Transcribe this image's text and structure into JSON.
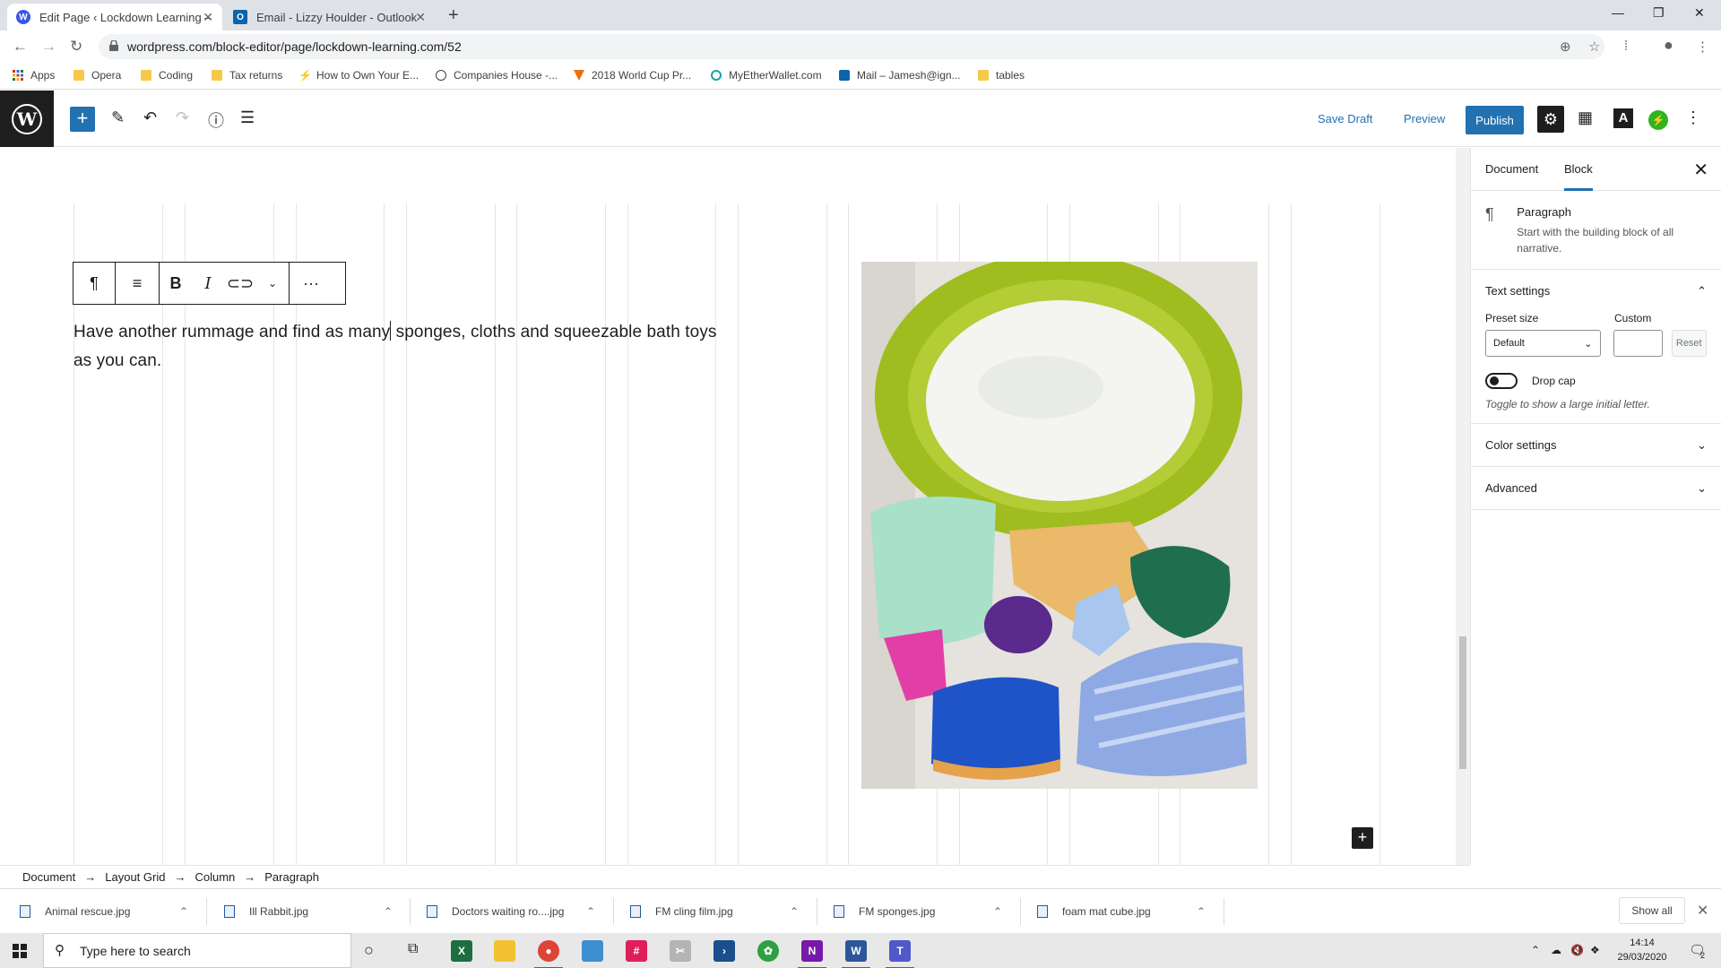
{
  "browser": {
    "tabs": [
      {
        "title": "Edit Page ‹ Lockdown Learning –",
        "active": true
      },
      {
        "title": "Email - Lizzy Houlder - Outlook",
        "active": false
      }
    ],
    "url": "wordpress.com/block-editor/page/lockdown-learning.com/52",
    "bookmarks": [
      {
        "label": "Apps",
        "icon": "apps-grid-icon"
      },
      {
        "label": "Opera",
        "icon": "folder-icon"
      },
      {
        "label": "Coding",
        "icon": "folder-icon"
      },
      {
        "label": "Tax returns",
        "icon": "folder-icon"
      },
      {
        "label": "How to Own Your E...",
        "icon": "lightning-icon"
      },
      {
        "label": "Companies House -...",
        "icon": "globe-icon"
      },
      {
        "label": "2018 World Cup Pr...",
        "icon": "site-icon"
      },
      {
        "label": "MyEtherWallet.com",
        "icon": "site-icon"
      },
      {
        "label": "Mail – Jamesh@ign...",
        "icon": "outlook-icon"
      },
      {
        "label": "tables",
        "icon": "folder-icon"
      }
    ]
  },
  "editor": {
    "save_draft": "Save Draft",
    "preview": "Preview",
    "publish": "Publish",
    "paragraph_text_before": "Have another rummage and find as many",
    "paragraph_text_after": " sponges, cloths and squeezable bath toys as you can."
  },
  "sidebar": {
    "tabs": [
      "Document",
      "Block"
    ],
    "active_tab": "Block",
    "block_name": "Paragraph",
    "block_description": "Start with the building block of all narrative.",
    "text_settings": {
      "title": "Text settings",
      "preset_label": "Preset size",
      "preset_value": "Default",
      "custom_label": "Custom",
      "custom_value": "",
      "reset_label": "Reset",
      "dropcap_label": "Drop cap",
      "dropcap_on": false,
      "dropcap_help": "Toggle to show a large initial letter."
    },
    "color_settings": "Color settings",
    "advanced": "Advanced"
  },
  "breadcrumb": [
    "Document",
    "Layout Grid",
    "Column",
    "Paragraph"
  ],
  "downloads": [
    "Animal rescue.jpg",
    "Ill Rabbit.jpg",
    "Doctors waiting ro....jpg",
    "FM cling film.jpg",
    "FM sponges.jpg",
    "foam mat cube.jpg"
  ],
  "downloads_show_all": "Show all",
  "taskbar": {
    "search_placeholder": "Type here to search",
    "time": "14:14",
    "date": "29/03/2020",
    "notification_count": "2"
  },
  "colors": {
    "accent": "#2271b1",
    "wp_dark": "#1e1e1e"
  }
}
